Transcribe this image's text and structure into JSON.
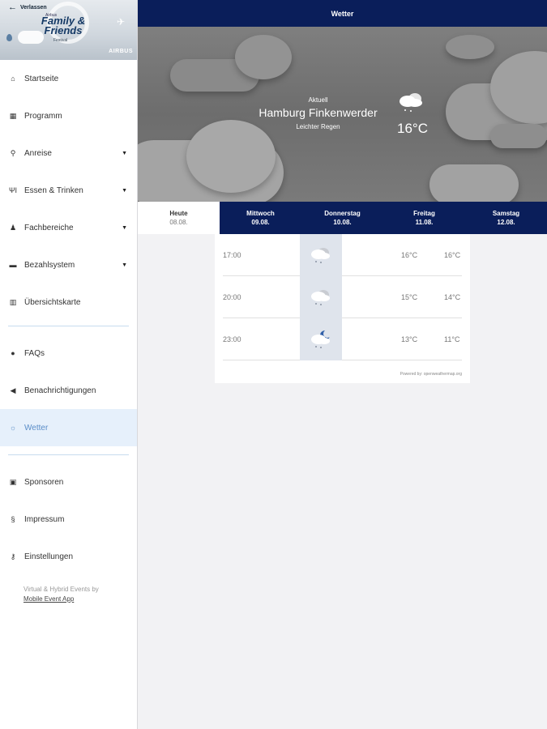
{
  "banner": {
    "back_label": "Verlassen",
    "small_text": "Airbus",
    "title": "Family & Friends",
    "subtitle": "Festival",
    "brand": "AIRBUS"
  },
  "sidebar": {
    "items": [
      {
        "label": "Startseite",
        "icon": "home-icon",
        "has_chevron": false
      },
      {
        "label": "Programm",
        "icon": "calendar-icon",
        "has_chevron": false
      },
      {
        "label": "Anreise",
        "icon": "map-pin-icon",
        "has_chevron": true
      },
      {
        "label": "Essen & Trinken",
        "icon": "fork-knife-icon",
        "has_chevron": true
      },
      {
        "label": "Fachbereiche",
        "icon": "person-icon",
        "has_chevron": true
      },
      {
        "label": "Bezahlsystem",
        "icon": "folder-icon",
        "has_chevron": true
      },
      {
        "label": "Übersichtskarte",
        "icon": "map-icon",
        "has_chevron": false
      },
      {
        "label": "FAQs",
        "icon": "lightbulb-icon",
        "has_chevron": false
      },
      {
        "label": "Benachrichtigungen",
        "icon": "megaphone-icon",
        "has_chevron": false
      },
      {
        "label": "Wetter",
        "icon": "sun-icon",
        "has_chevron": false,
        "active": true
      },
      {
        "label": "Sponsoren",
        "icon": "book-icon",
        "has_chevron": false
      },
      {
        "label": "Impressum",
        "icon": "section-icon",
        "has_chevron": false
      },
      {
        "label": "Einstellungen",
        "icon": "key-icon",
        "has_chevron": false
      }
    ],
    "credit_line1": "Virtual & Hybrid Events by",
    "credit_link": "Mobile Event App"
  },
  "header": {
    "title": "Wetter"
  },
  "current": {
    "label": "Aktuell",
    "city": "Hamburg Finkenwerder",
    "condition": "Leichter Regen",
    "temperature": "16°C",
    "icon": "cloud-rain-icon"
  },
  "days": [
    {
      "name": "Heute",
      "date": "08.08.",
      "selected": true
    },
    {
      "name": "Mittwoch",
      "date": "09.08."
    },
    {
      "name": "Donnerstag",
      "date": "10.08."
    },
    {
      "name": "Freitag",
      "date": "11.08."
    },
    {
      "name": "Samstag",
      "date": "12.08."
    }
  ],
  "forecast": [
    {
      "time": "17:00",
      "icon": "cloud-rain-icon",
      "temp_high": "16°C",
      "temp_low": "16°C"
    },
    {
      "time": "20:00",
      "icon": "cloud-rain-icon",
      "temp_high": "15°C",
      "temp_low": "14°C"
    },
    {
      "time": "23:00",
      "icon": "cloud-moon-rain-icon",
      "temp_high": "13°C",
      "temp_low": "11°C"
    }
  ],
  "powered_by": "Powered by: openweathermap.org",
  "colors": {
    "navy": "#0a1e5a",
    "active_bg": "#e6f0fb",
    "active_text": "#5a8dc8"
  }
}
